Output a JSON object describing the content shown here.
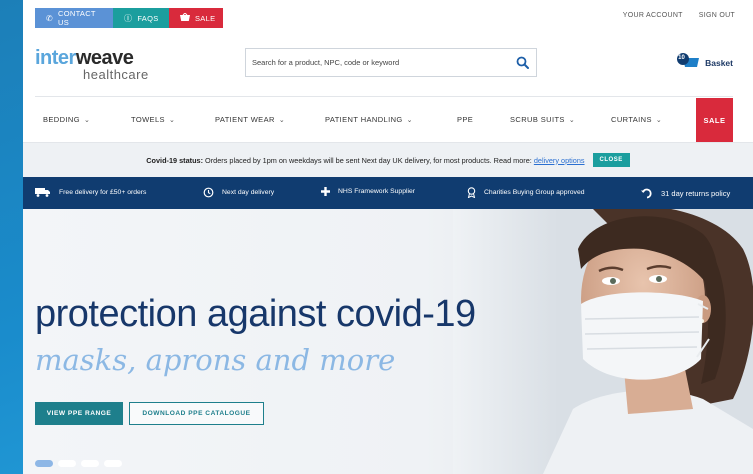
{
  "topbar": {
    "buttons": [
      {
        "label": "CONTACT US",
        "icon": "phone-icon"
      },
      {
        "label": "FAQS",
        "icon": "info-icon"
      },
      {
        "label": "SALE",
        "icon": "basket-icon"
      }
    ],
    "links": [
      "YOUR ACCOUNT",
      "SIGN OUT"
    ]
  },
  "header": {
    "logo": {
      "part1": "inter",
      "part2": "weave",
      "sub": "healthcare"
    },
    "search_placeholder": "Search for a product, NPC, code or keyword",
    "basket": {
      "count": "10",
      "label": "Basket"
    }
  },
  "nav": {
    "items": [
      "BEDDING",
      "TOWELS",
      "PATIENT WEAR",
      "PATIENT HANDLING",
      "PPE",
      "SCRUB SUITS",
      "CURTAINS"
    ],
    "sale": "SALE"
  },
  "covid": {
    "status_label": "Covid-19 status:",
    "message": " Orders placed by 1pm on weekdays will be sent Next day UK delivery, for most products. Read more: ",
    "link": "delivery options",
    "close": "CLOSE"
  },
  "features": [
    {
      "label": "Free delivery for £50+ orders",
      "icon": "truck-icon"
    },
    {
      "label": "Next day delivery",
      "icon": "clock-icon"
    },
    {
      "label": "NHS Framework Supplier",
      "icon": "plus-icon"
    },
    {
      "label": "Charities Buying Group approved",
      "icon": "award-icon"
    },
    {
      "label": "31 day returns policy",
      "icon": "return-icon"
    }
  ],
  "hero": {
    "title": "protection against covid-19",
    "subtitle": "masks, aprons and more",
    "primary_btn": "VIEW PPE RANGE",
    "secondary_btn": "DOWNLOAD PPE CATALOGUE",
    "slides": 4,
    "active_slide": 1
  },
  "colors": {
    "accent": "#1b9e9e",
    "sale": "#d92a3c",
    "navy": "#103c70"
  }
}
